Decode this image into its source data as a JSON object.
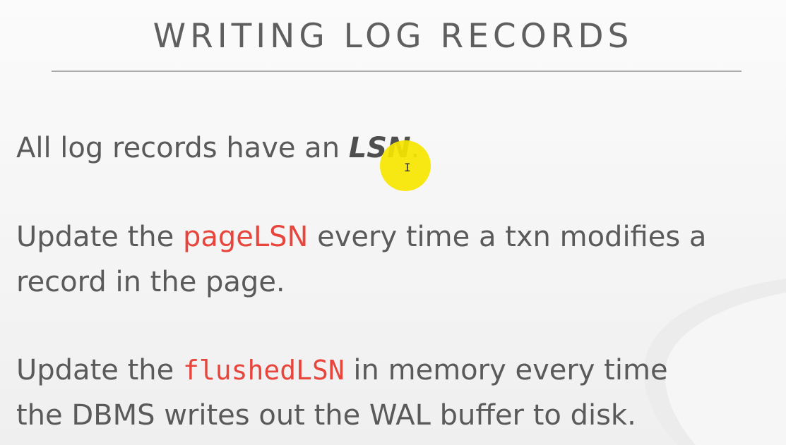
{
  "slide": {
    "title": "WRITING LOG RECORDS",
    "paragraphs": {
      "p1": {
        "before": "All log records have an ",
        "term": "LSN",
        "after": "."
      },
      "p2": {
        "before": "Update the ",
        "term": "pageLSN",
        "after_line1": " every time a txn modifies a",
        "line2": "record in the page."
      },
      "p3": {
        "before": "Update the ",
        "term": "flushedLSN",
        "after_line1": " in memory every time",
        "line2": "the DBMS writes out the WAL buffer to disk."
      }
    }
  },
  "colors": {
    "highlight_term": "#e8453c",
    "cursor_highlight": "#f6e600",
    "body_text": "#5a5a5a"
  },
  "icons": {
    "cursor": "mouse-cursor-ibeam-icon"
  }
}
